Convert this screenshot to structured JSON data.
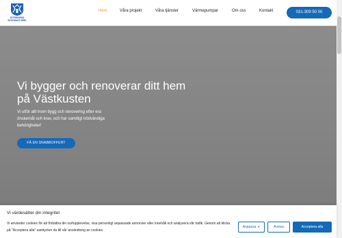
{
  "header": {
    "logo_line1": "GÖTEBORGS",
    "logo_line2": "BYGGHANTVERK",
    "nav": [
      {
        "label": "Hem"
      },
      {
        "label": "Våra projekt"
      },
      {
        "label": "Våra tjänster"
      },
      {
        "label": "Värmepumpar"
      },
      {
        "label": "Om oss"
      },
      {
        "label": "Kontakt"
      }
    ],
    "phone": "031-309 50 00"
  },
  "hero": {
    "title": "Vi bygger och renoverar ditt hem på Västkusten",
    "body": "Vi utför allt inom bygg och renovering efter era önskemål och krav, och har samtligt nödvändiga behörigheter!",
    "cta": "FÅ EN SNABBOFFERT"
  },
  "cookie": {
    "title": "Vi värdesätter din integritet",
    "text": "Vi använder cookies för att förbättra din surfupplevelse, visa personligt anpassade annonser eller innehåll och analysera vår trafik. Genom att klicka på \"Acceptera alla\" samtycker du till vår användning av cookies.",
    "customize": "Anpassa",
    "reject": "Avvisa",
    "accept": "Acceptera alla"
  },
  "colors": {
    "accent": "#1469b8",
    "active_nav": "#f29a2e",
    "hero_bg": "#858585"
  },
  "icons": {
    "logo": "coat-of-arms-icon",
    "dropdown": "caret-down-icon"
  }
}
